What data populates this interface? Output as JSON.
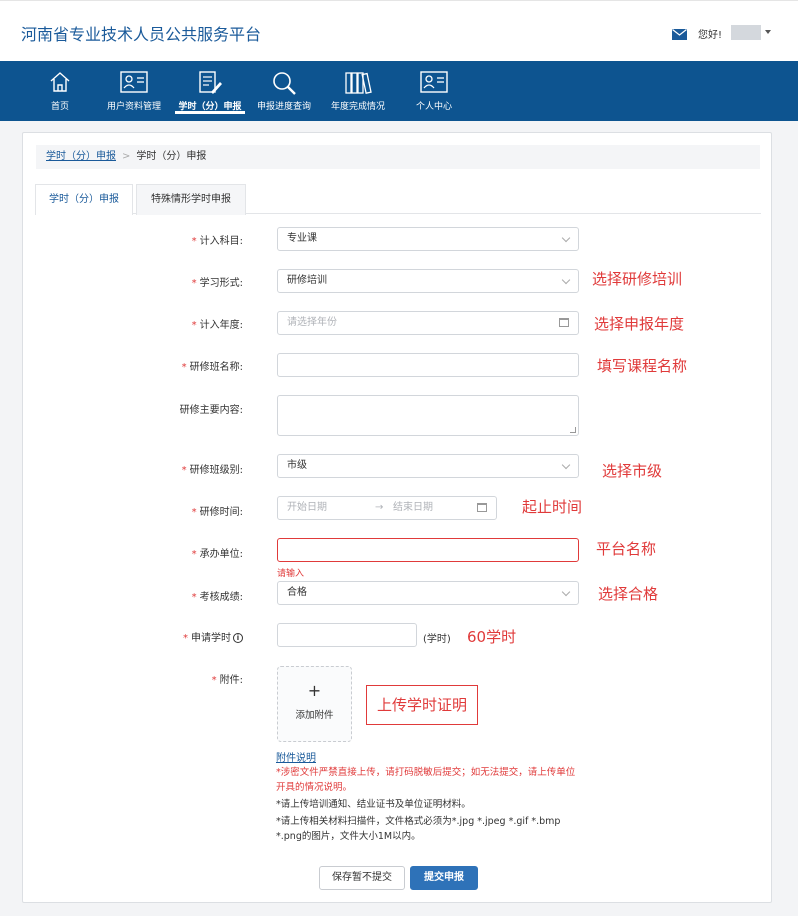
{
  "header": {
    "site_title": "河南省专业技术人员公共服务平台",
    "greeting": "您好!"
  },
  "nav": [
    {
      "label": "首页",
      "icon": "home-icon"
    },
    {
      "label": "用户资料管理",
      "icon": "user-card-icon"
    },
    {
      "label": "学时（分）申报",
      "icon": "document-edit-icon",
      "active": true
    },
    {
      "label": "申报进度查询",
      "icon": "search-icon"
    },
    {
      "label": "年度完成情况",
      "icon": "books-icon"
    },
    {
      "label": "个人中心",
      "icon": "profile-card-icon"
    }
  ],
  "breadcrumb": {
    "link": "学时（分）申报",
    "separator": ">",
    "current": "学时（分）申报"
  },
  "tabs": [
    {
      "label": "学时（分）申报",
      "active": true
    },
    {
      "label": "特殊情形学时申报",
      "active": false
    }
  ],
  "form": {
    "required_mark": "*",
    "subject": {
      "label": "计入科目:",
      "value": "专业课"
    },
    "study_form": {
      "label": "学习形式:",
      "value": "研修培训"
    },
    "year": {
      "label": "计入年度:",
      "placeholder": "请选择年份"
    },
    "class_name": {
      "label": "研修班名称:",
      "value": ""
    },
    "content": {
      "label": "研修主要内容:",
      "value": ""
    },
    "level": {
      "label": "研修班级别:",
      "value": "市级"
    },
    "time": {
      "label": "研修时间:",
      "start_placeholder": "开始日期",
      "arrow": "→",
      "end_placeholder": "结束日期"
    },
    "organizer": {
      "label": "承办单位:",
      "value": "",
      "error": "请输入"
    },
    "result": {
      "label": "考核成绩:",
      "value": "合格"
    },
    "hours": {
      "label": "申请学时",
      "value": "",
      "unit": "(学时)",
      "info_glyph": "i"
    },
    "attachment": {
      "label": "附件:",
      "plus": "+",
      "upload_label": "添加附件"
    },
    "help_link": "附件说明",
    "notes": {
      "red": "*涉密文件严禁直接上传，请打码脱敏后提交；如无法提交，请上传单位开具的情况说明。",
      "line2": "*请上传培训通知、结业证书及单位证明材料。",
      "line3": "*请上传相关材料扫描件，文件格式必须为*.jpg *.jpeg *.gif *.bmp *.png的图片，文件大小1M以内。"
    }
  },
  "buttons": {
    "save": "保存暂不提交",
    "submit": "提交申报"
  },
  "annotations": {
    "study_form": "选择研修培训",
    "year": "选择申报年度",
    "class_name": "填写课程名称",
    "level": "选择市级",
    "time": "起止时间",
    "organizer": "平台名称",
    "result": "选择合格",
    "hours": "60学时",
    "attachment": "上传学时证明"
  },
  "colors": {
    "nav_bg": "#0d5490",
    "title_blue": "#1a5a9a",
    "error_red": "#e03a3a",
    "primary_button": "#2e72b8"
  }
}
